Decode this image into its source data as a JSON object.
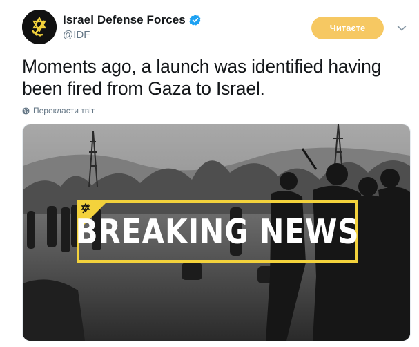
{
  "account": {
    "name": "Israel Defense Forces",
    "handle": "@IDF",
    "verified": true,
    "avatar_icon": "idf-emblem-icon"
  },
  "follow_button": {
    "label": "Читаєте"
  },
  "menu_icon": "chevron-down-icon",
  "tweet": {
    "text": "Moments ago, a launch was identified having been fired from Gaza to Israel.",
    "translate_label": "Перекласти твіт"
  },
  "media": {
    "overlay_text": "BREAKING NEWS",
    "badge_icon": "idf-emblem-icon"
  },
  "colors": {
    "follow_button_bg": "#f6c862",
    "verified": "#1da1f2",
    "banner_frame": "#f3d23c",
    "text_secondary": "#657786"
  }
}
